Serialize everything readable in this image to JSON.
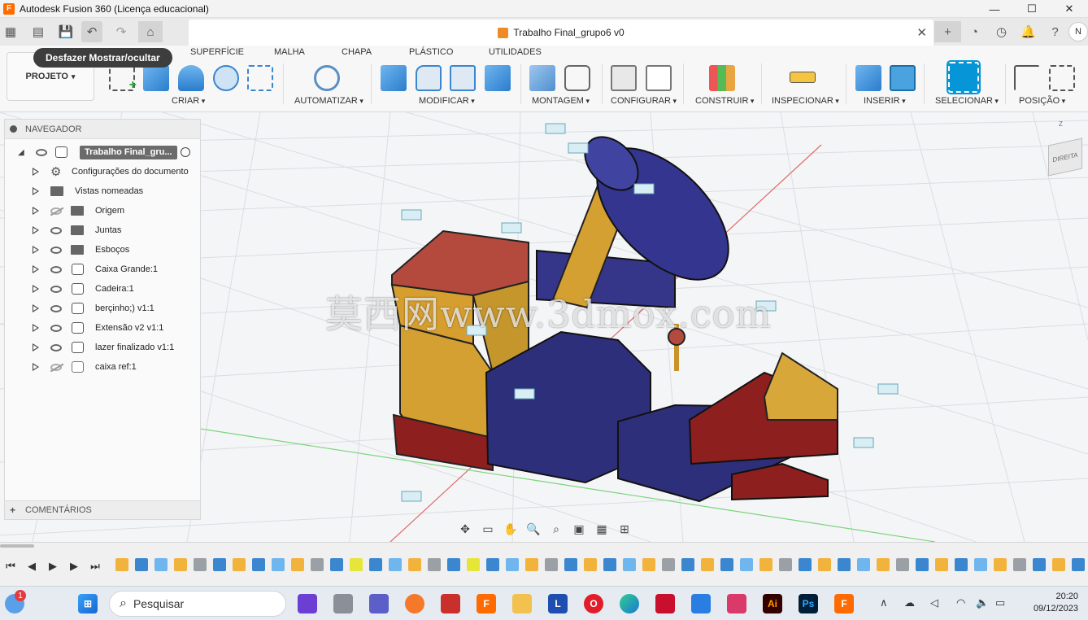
{
  "window": {
    "title": "Autodesk Fusion 360 (Licença educacional)"
  },
  "document": {
    "tab_title": "Trabalho Final_grupo6 v0"
  },
  "user": {
    "initial": "N"
  },
  "tooltip": "Desfazer Mostrar/ocultar",
  "ribbon": {
    "projeto": "PROJETO",
    "tabs": [
      "SUPERFÍCIE",
      "MALHA",
      "CHAPA",
      "PLÁSTICO",
      "UTILIDADES"
    ],
    "groups": [
      "CRIAR",
      "AUTOMATIZAR",
      "MODIFICAR",
      "MONTAGEM",
      "CONFIGURAR",
      "CONSTRUIR",
      "INSPECIONAR",
      "INSERIR",
      "SELECIONAR",
      "POSIÇÃO"
    ]
  },
  "navigator": {
    "header": "NAVEGADOR",
    "root": "Trabalho Final_gru...",
    "items": [
      {
        "label": "Configurações do documento",
        "kind": "gear"
      },
      {
        "label": "Vistas nomeadas",
        "kind": "folder"
      },
      {
        "label": "Origem",
        "kind": "folder",
        "hidden": true
      },
      {
        "label": "Juntas",
        "kind": "folder"
      },
      {
        "label": "Esboços",
        "kind": "folder"
      },
      {
        "label": "Caixa Grande:1",
        "kind": "component"
      },
      {
        "label": "Cadeira:1",
        "kind": "component"
      },
      {
        "label": "berçinho;) v1:1",
        "kind": "component"
      },
      {
        "label": "Extensão v2 v1:1",
        "kind": "component"
      },
      {
        "label": "lazer finalizado v1:1",
        "kind": "component"
      },
      {
        "label": "caixa ref:1",
        "kind": "body",
        "hidden": true
      }
    ],
    "footer": "COMENTÁRIOS"
  },
  "viewcube": {
    "face": "DIREITA",
    "axis_z": "Z"
  },
  "watermark": "莫西网www.3dmox.com",
  "taskbar": {
    "search_placeholder": "Pesquisar",
    "time": "20:20",
    "date": "09/12/2023",
    "notification_count": "1"
  },
  "colors": {
    "accent": "#0696d7",
    "brand": "#ff6b00",
    "model_red": "#a8352b",
    "model_yellow": "#d9a42e",
    "model_navy": "#2e2f7a",
    "model_dark_red": "#8e1f1f"
  }
}
